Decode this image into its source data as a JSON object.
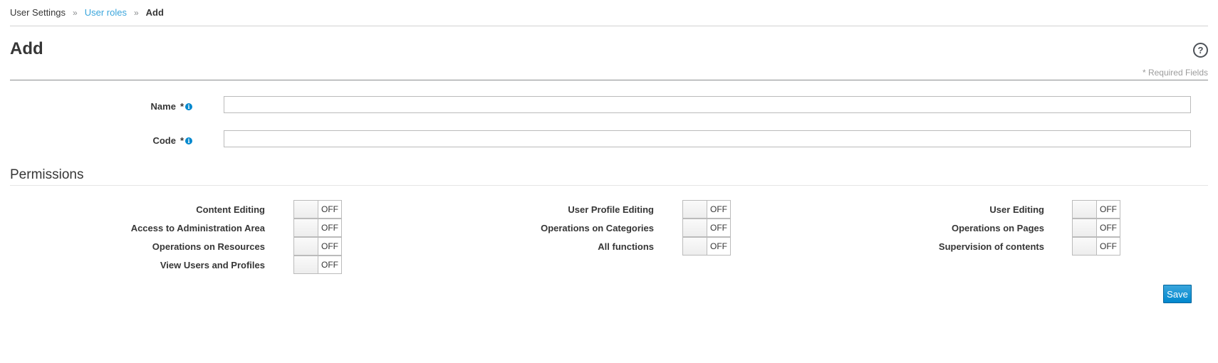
{
  "breadcrumb": {
    "items": [
      "User Settings",
      "User roles",
      "Add"
    ],
    "separator": "»"
  },
  "page": {
    "title": "Add",
    "required_note": "* Required Fields"
  },
  "form": {
    "name": {
      "label": "Name",
      "required": "*",
      "value": ""
    },
    "code": {
      "label": "Code",
      "required": "*",
      "value": ""
    }
  },
  "permissions": {
    "title": "Permissions",
    "items": [
      {
        "label": "Content Editing",
        "state": "OFF"
      },
      {
        "label": "User Profile Editing",
        "state": "OFF"
      },
      {
        "label": "User Editing",
        "state": "OFF"
      },
      {
        "label": "Access to Administration Area",
        "state": "OFF"
      },
      {
        "label": "Operations on Categories",
        "state": "OFF"
      },
      {
        "label": "Operations on Pages",
        "state": "OFF"
      },
      {
        "label": "Operations on Resources",
        "state": "OFF"
      },
      {
        "label": "All functions",
        "state": "OFF"
      },
      {
        "label": "Supervision of contents",
        "state": "OFF"
      },
      {
        "label": "View Users and Profiles",
        "state": "OFF"
      }
    ]
  },
  "actions": {
    "save_label": "Save"
  },
  "icons": {
    "help": "help-circle-icon",
    "info": "info-icon"
  },
  "colors": {
    "link": "#39a5dc",
    "primary": "#0088ce",
    "info": "#0088ce"
  }
}
